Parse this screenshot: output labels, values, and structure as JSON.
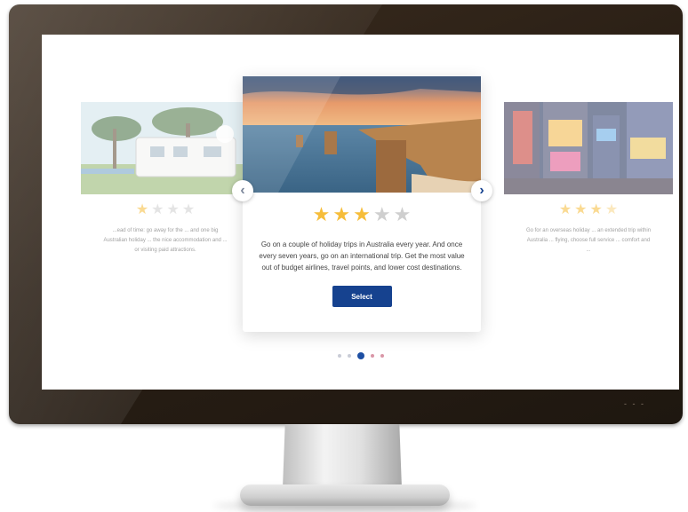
{
  "carousel": {
    "left_card": {
      "image_alt": "campervan",
      "rating": 1,
      "description": "...ead of time: go away for the ... and one big Australian holiday ... the nice accommodation and ... or visiting paid attractions."
    },
    "center_card": {
      "image_alt": "Twelve Apostles coastline",
      "rating": 3,
      "description": "Go on a couple of holiday trips in Australia every year. And once every seven years, go on an international trip. Get the most value out of budget airlines, travel points, and lower cost destinations.",
      "button_label": "Select"
    },
    "right_card": {
      "image_alt": "Times Square at night",
      "rating": 3.5,
      "description": "Go for an overseas holiday ... an extended trip within Australia ... flying, choose full service ... comfort and ..."
    },
    "prev_icon": "chevron-left-icon",
    "next_icon": "chevron-right-icon",
    "pagination_count": 5,
    "active_index": 2
  },
  "bezel_indicator": "- - -",
  "colors": {
    "accent": "#16428f",
    "star_on": "#f6bd3a",
    "star_off": "#cfcfcf",
    "bezel": "#2a1f15"
  }
}
